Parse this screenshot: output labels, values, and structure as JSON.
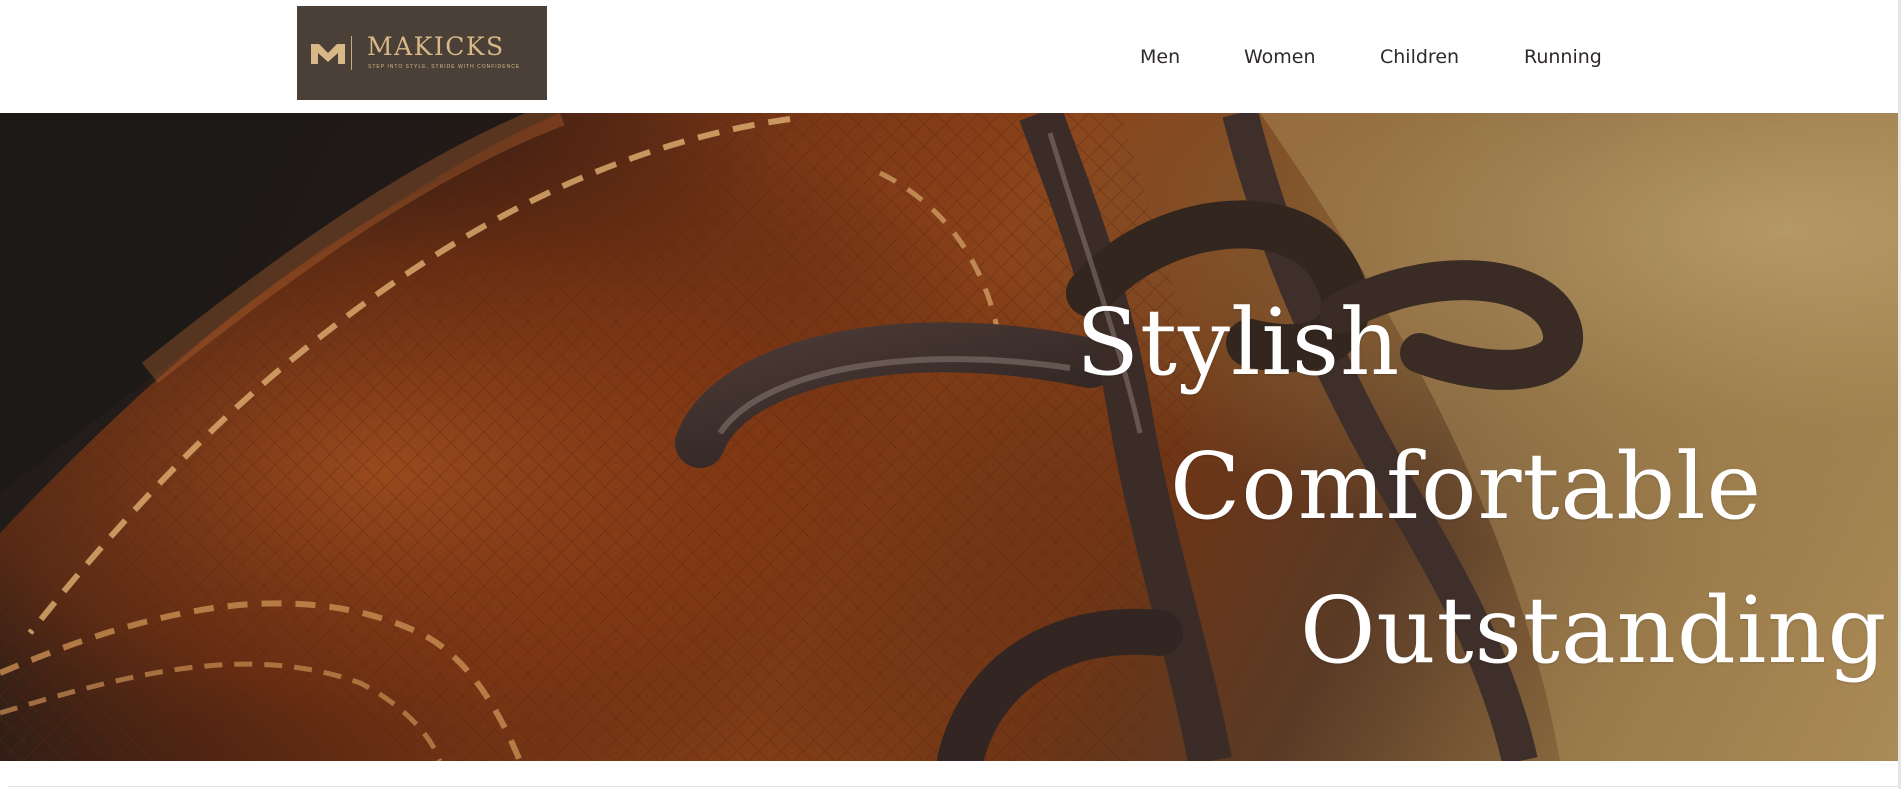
{
  "header": {
    "logo": {
      "name": "MAKICKS",
      "tagline": "STEP INTO STYLE, STRIDE WITH CONFIDENCE",
      "background_color": "#4a4038",
      "accent_color": "#d8b886"
    },
    "nav": {
      "items": [
        {
          "label": "Men"
        },
        {
          "label": "Women"
        },
        {
          "label": "Children"
        },
        {
          "label": "Running"
        }
      ]
    }
  },
  "hero": {
    "image": "leather-shoe-laces-closeup",
    "lines": [
      "Stylish",
      "Comfortable",
      "Outstanding"
    ],
    "text_color": "#ffffff"
  }
}
